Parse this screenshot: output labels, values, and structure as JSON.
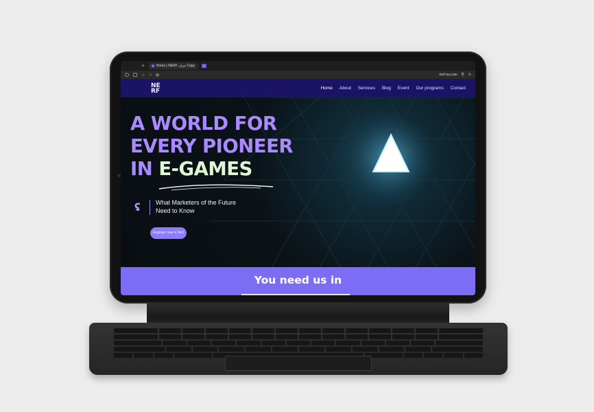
{
  "browser": {
    "tab_title": "Home | NERF نيرف Copy",
    "url": "nerf-sa.com"
  },
  "site": {
    "logo": "NE RF",
    "nav": [
      "Home",
      "About",
      "Services",
      "Blog",
      "Event",
      "Our programs",
      "Contact"
    ],
    "hero": {
      "line1": "A WORLD FOR",
      "line2": "EVERY PIONEER",
      "line3_prefix": "IN",
      "line3_accent": "E-GAMES",
      "tagline": "What Marketers of the Future Need to Know",
      "register_button": "Register now in Nerf"
    },
    "band_text": "You need us in"
  },
  "colors": {
    "accent_purple": "#a98bff",
    "nav_bg": "#1b1466",
    "band_bg": "#7d6df4",
    "accent_green": "#dff6d4"
  },
  "icons": [
    "new-tab-icon",
    "sidebar-icon",
    "bookmark-icon",
    "home-icon",
    "triangle-icon",
    "tagline-logo-icon"
  ]
}
